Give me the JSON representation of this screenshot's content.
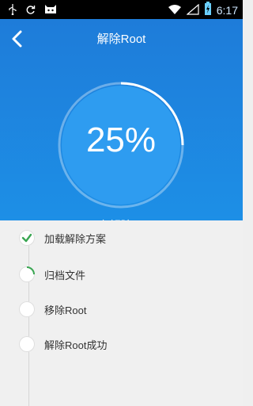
{
  "status_bar": {
    "time": "6:17",
    "battery_icon": "battery-charging-icon",
    "wifi_icon": "wifi-icon",
    "signal_icon": "signal-icon"
  },
  "header": {
    "title": "解除Root",
    "progress_percent": "25%",
    "progress_value": 0.25,
    "status_text": "正在解除Root"
  },
  "steps": [
    {
      "label": "加载解除方案",
      "state": "done"
    },
    {
      "label": "归档文件",
      "state": "in-progress"
    },
    {
      "label": "移除Root",
      "state": "pending"
    },
    {
      "label": "解除Root成功",
      "state": "pending"
    }
  ],
  "colors": {
    "header_top": "#1e7cd9",
    "header_bottom": "#1d8fe6",
    "check_green": "#3aa652"
  }
}
